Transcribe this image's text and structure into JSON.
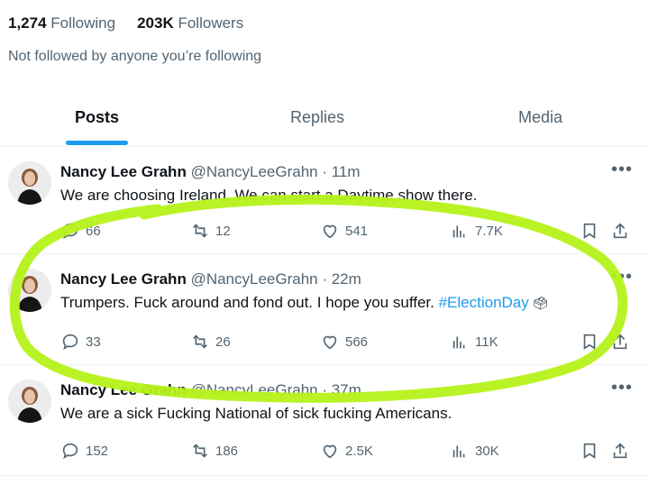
{
  "profile": {
    "following_count": "1,274",
    "following_label": "Following",
    "followers_count": "203K",
    "followers_label": "Followers",
    "not_followed": "Not followed by anyone you’re following"
  },
  "tabs": [
    {
      "label": "Posts",
      "active": true
    },
    {
      "label": "Replies",
      "active": false
    },
    {
      "label": "Media",
      "active": false
    }
  ],
  "posts": [
    {
      "name": "Nancy Lee Grahn",
      "handle": "@NancyLeeGrahn · 11m",
      "text": "We are choosing Ireland. We can start a Daytime show there.",
      "hashtag": "",
      "replies": "66",
      "reposts": "12",
      "likes": "541",
      "views": "7.7K"
    },
    {
      "name": "Nancy Lee Grahn",
      "handle": "@NancyLeeGrahn · 22m",
      "text": "Trumpers. Fuck around and fond out. I hope you suffer. ",
      "hashtag": "#ElectionDay",
      "replies": "33",
      "reposts": "26",
      "likes": "566",
      "views": "11K"
    },
    {
      "name": "Nancy Lee Grahn",
      "handle": "@NancyLeeGrahn · 37m",
      "text": "We are a sick Fucking National of sick fucking  Americans.",
      "hashtag": "",
      "replies": "152",
      "reposts": "186",
      "likes": "2.5K",
      "views": "30K"
    }
  ],
  "icons": {
    "reply": "reply-icon",
    "repost": "repost-icon",
    "like": "like-icon",
    "views": "views-icon",
    "bookmark": "bookmark-icon",
    "share": "share-icon",
    "more": "more-icon"
  },
  "colors": {
    "accent": "#1d9bf0",
    "highlight": "#b5f21a",
    "muted": "#536471"
  }
}
